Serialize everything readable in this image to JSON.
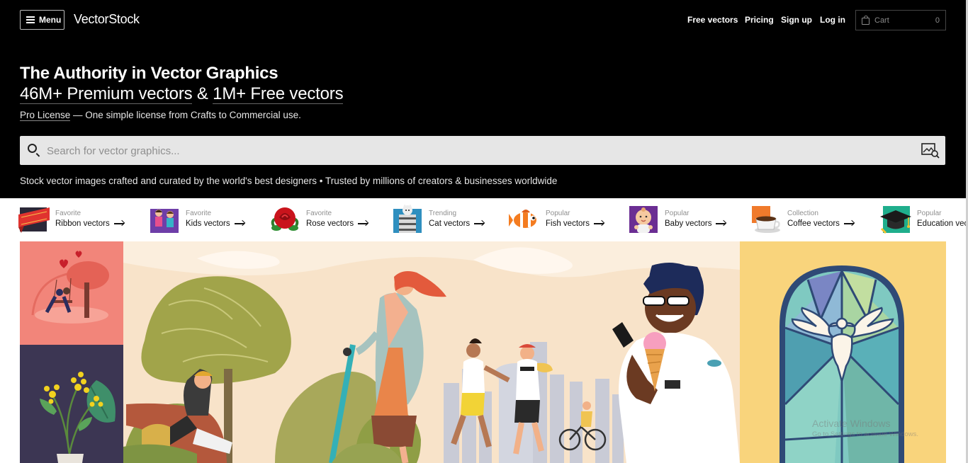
{
  "header": {
    "menu_label": "Menu",
    "logo": "VectorStock",
    "nav": [
      "Free vectors",
      "Pricing",
      "Sign up",
      "Log in"
    ],
    "cart_label": "Cart",
    "cart_count": "0"
  },
  "hero": {
    "headline": "The Authority in Vector Graphics",
    "premium": "46M+ Premium vectors",
    "amp": "&",
    "free": "1M+ Free vectors",
    "license_link": "Pro License",
    "license_text": " — One simple license from Crafts to Commercial use.",
    "tagline": "Stock vector images crafted and curated by the world's best designers  •  Trusted by millions of creators & businesses worldwide"
  },
  "search": {
    "placeholder": "Search for vector graphics..."
  },
  "categories": [
    {
      "tag": "Favorite",
      "label": "Ribbon vectors",
      "icon": "ribbon-icon"
    },
    {
      "tag": "Favorite",
      "label": "Kids vectors",
      "icon": "kids-icon"
    },
    {
      "tag": "Favorite",
      "label": "Rose vectors",
      "icon": "rose-icon"
    },
    {
      "tag": "Trending",
      "label": "Cat vectors",
      "icon": "cat-icon"
    },
    {
      "tag": "Popular",
      "label": "Fish vectors",
      "icon": "fish-icon"
    },
    {
      "tag": "Popular",
      "label": "Baby vectors",
      "icon": "baby-icon"
    },
    {
      "tag": "Collection",
      "label": "Coffee vectors",
      "icon": "coffee-icon"
    },
    {
      "tag": "Popular",
      "label": "Education vectors",
      "icon": "graduation-cap-icon"
    }
  ],
  "colors": {
    "hero_bg": "#000000",
    "search_bg": "#e6e6e6",
    "love_tile": "#f2857a",
    "plant_tile": "#3c3653",
    "park_sky": "#f8e3c9",
    "dove_tile": "#f9d47c"
  },
  "watermark": {
    "line1": "Activate Windows",
    "line2": "Go to Settings to activate Windows."
  }
}
